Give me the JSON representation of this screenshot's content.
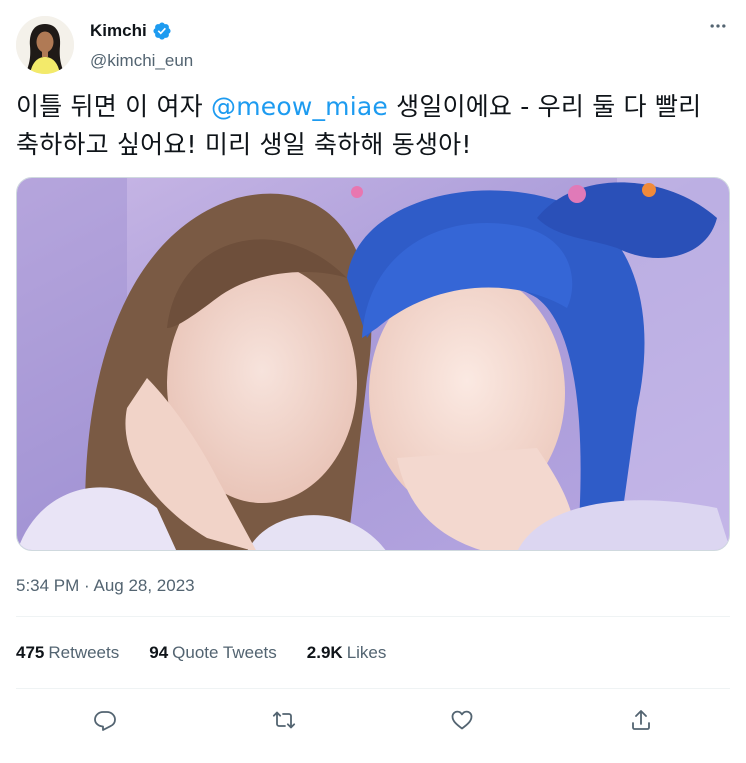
{
  "author": {
    "display_name": "Kimchi",
    "handle": "@kimchi_eun",
    "verified": true,
    "avatar_icon": "woman-avatar"
  },
  "tweet": {
    "text_before": "이틀 뒤면 이 여자 ",
    "mention": "@meow_miae",
    "text_after": " 생일이에요 - 우리 둘 다 빨리 축하하고 싶어요! 미리 생일 축하해 동생아!",
    "timestamp": "5:34 PM · Aug 28, 2023"
  },
  "stats": {
    "retweets_count": "475",
    "retweets_label": "Retweets",
    "quotes_count": "94",
    "quotes_label": "Quote Tweets",
    "likes_count": "2.9K",
    "likes_label": "Likes"
  },
  "actions": [
    "reply-icon",
    "retweet-icon",
    "like-icon",
    "share-icon"
  ],
  "colors": {
    "accent": "#1d9bf0",
    "text": "#0f1419",
    "secondary": "#536471",
    "divider": "#eff3f4"
  }
}
